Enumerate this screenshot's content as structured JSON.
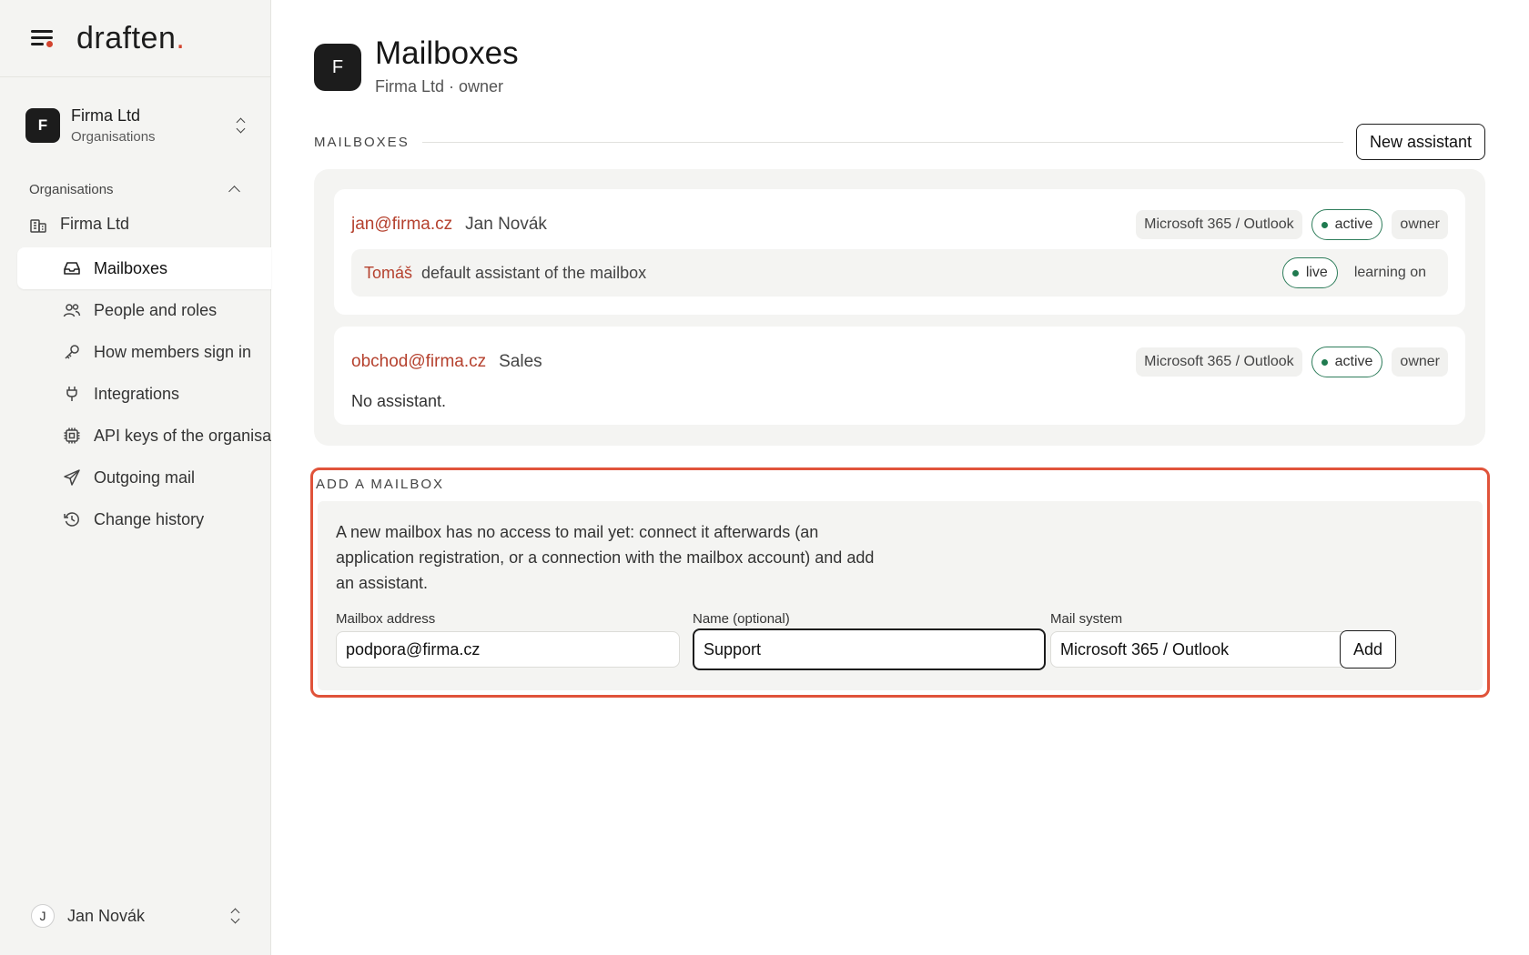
{
  "brand": {
    "logo_text": "draften",
    "logo_dot": ".",
    "accent": "#d2442f"
  },
  "org_switcher": {
    "avatar_letter": "F",
    "name": "Firma Ltd",
    "subtitle": "Organisations"
  },
  "sidebar": {
    "section_label": "Organisations",
    "org_item": "Firma Ltd",
    "items": [
      {
        "label": "Mailboxes",
        "icon": "inbox-icon",
        "active": true
      },
      {
        "label": "People and roles",
        "icon": "users-icon"
      },
      {
        "label": "How members sign in",
        "icon": "key-icon"
      },
      {
        "label": "Integrations",
        "icon": "plug-icon"
      },
      {
        "label": "API keys of the organisation",
        "icon": "chip-icon"
      },
      {
        "label": "Outgoing mail",
        "icon": "send-icon"
      },
      {
        "label": "Change history",
        "icon": "history-icon"
      }
    ],
    "user": {
      "avatar_letter": "J",
      "name": "Jan Novák"
    }
  },
  "header": {
    "avatar_letter": "F",
    "title": "Mailboxes",
    "subtitle": "Firma Ltd · owner"
  },
  "mailboxes_section": {
    "label": "MAILBOXES",
    "new_button": "New assistant",
    "items": [
      {
        "email": "jan@firma.cz",
        "name": "Jan Novák",
        "system": "Microsoft 365 / Outlook",
        "status": "active",
        "role": "owner",
        "assistant": {
          "name": "Tomáš",
          "description": "default assistant of the mailbox",
          "state": "live",
          "learning": "learning on"
        }
      },
      {
        "email": "obchod@firma.cz",
        "name": "Sales",
        "system": "Microsoft 365 / Outlook",
        "status": "active",
        "role": "owner",
        "no_assistant": "No assistant."
      }
    ]
  },
  "add_mailbox": {
    "label": "ADD A MAILBOX",
    "description": "A new mailbox has no access to mail yet: connect it afterwards (an application registration, or a connection with the mailbox account) and add an assistant.",
    "address_label": "Mailbox address",
    "address_value": "podpora@firma.cz",
    "name_label": "Name (optional)",
    "name_value": "Support",
    "system_label": "Mail system",
    "system_value": "Microsoft 365 / Outlook",
    "add_button": "Add"
  },
  "colors": {
    "link": "#b5412e",
    "status_green": "#1f7a4f",
    "highlight": "#e0533a"
  }
}
